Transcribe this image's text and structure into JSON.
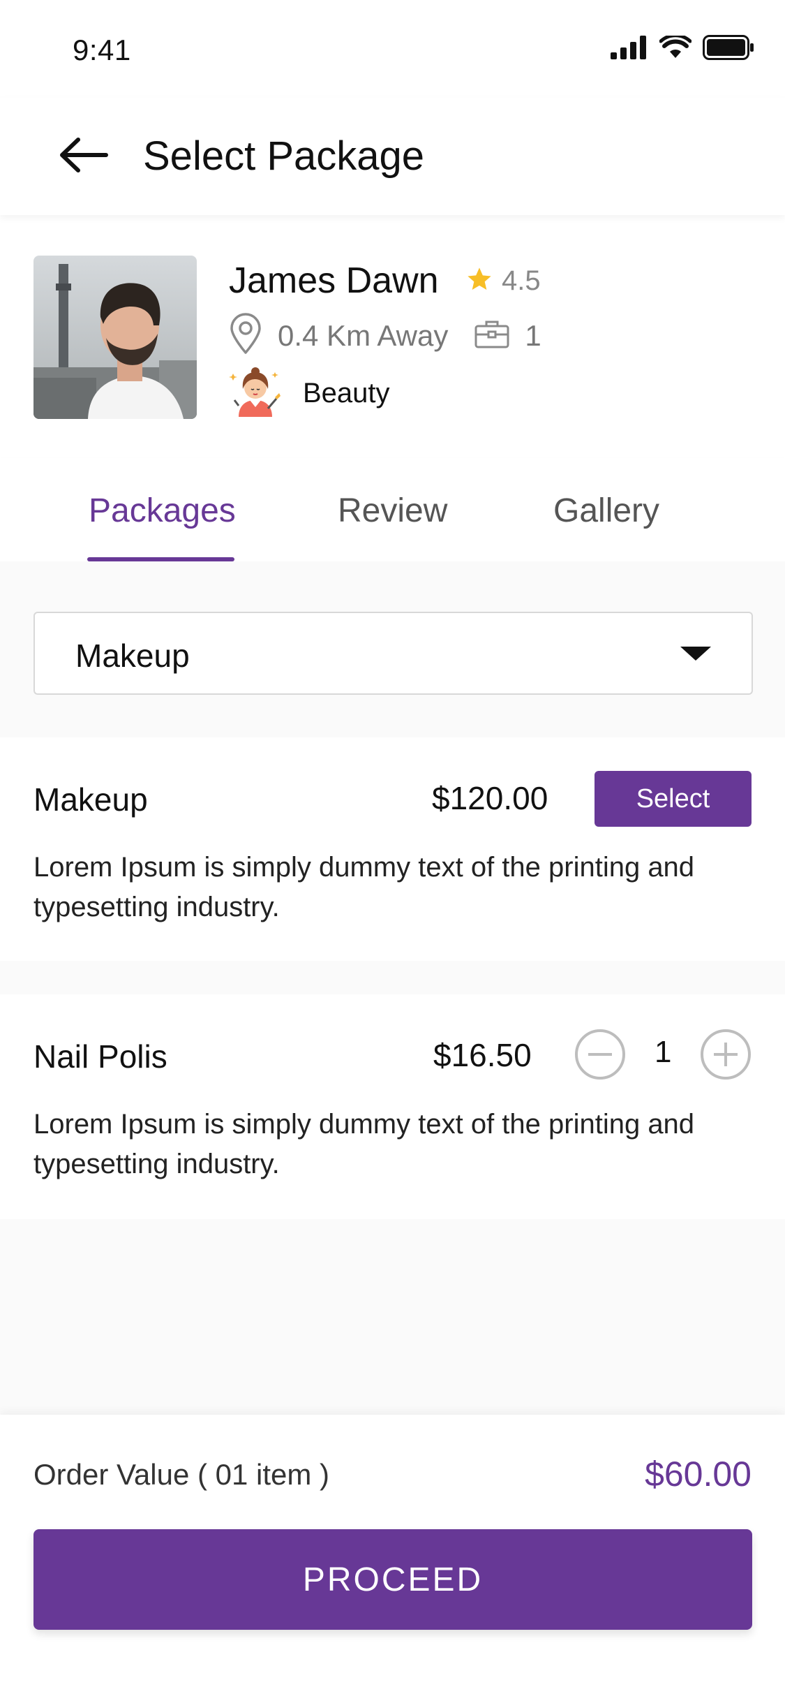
{
  "status_bar": {
    "time": "9:41",
    "icons": [
      "cellular-signal-icon",
      "wifi-icon",
      "battery-icon"
    ]
  },
  "header": {
    "title": "Select Package",
    "back_icon": "arrow-left-icon"
  },
  "provider": {
    "name": "James Dawn",
    "rating": "4.5",
    "distance": "0.4 Km Away",
    "jobs_count": "1",
    "category": "Beauty",
    "icons": {
      "rating": "star-icon",
      "distance": "location-pin-icon",
      "jobs": "briefcase-icon",
      "category": "beauty-makeup-icon"
    }
  },
  "tabs": {
    "items": [
      {
        "label": "Packages",
        "active": true
      },
      {
        "label": "Review",
        "active": false
      },
      {
        "label": "Gallery",
        "active": false
      }
    ]
  },
  "filter": {
    "selected": "Makeup"
  },
  "packages": [
    {
      "name": "Makeup",
      "price": "$120.00",
      "action_label": "Select",
      "description": "Lorem Ipsum is simply dummy text of the printing and typesetting industry."
    },
    {
      "name": "Nail Polis",
      "price": "$16.50",
      "quantity": "1",
      "description": "Lorem Ipsum is simply dummy text of the printing and typesetting industry."
    }
  ],
  "order": {
    "label": "Order Value ( 01 item )",
    "total": "$60.00",
    "proceed_label": "PROCEED"
  },
  "colors": {
    "accent": "#673896",
    "star": "#F7BE27",
    "muted_text": "#777777"
  }
}
